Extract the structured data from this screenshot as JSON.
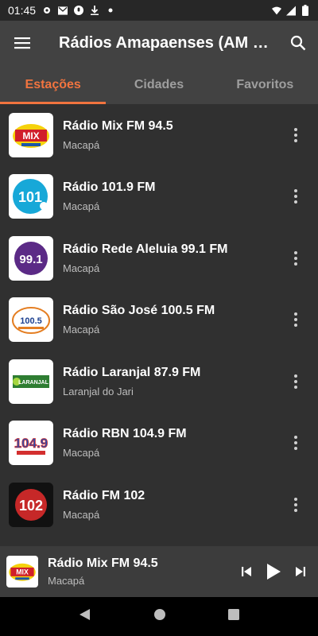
{
  "status_bar": {
    "time": "01:45"
  },
  "app_bar": {
    "title": "Rádios Amapaenses (AM e...",
    "menu_icon": "hamburger-menu-icon",
    "search_icon": "search-icon"
  },
  "tabs": [
    {
      "label": "Estações",
      "active": true
    },
    {
      "label": "Cidades",
      "active": false
    },
    {
      "label": "Favoritos",
      "active": false
    }
  ],
  "stations": [
    {
      "name": "Rádio Mix FM 94.5",
      "city": "Macapá",
      "logo_text": "MIX"
    },
    {
      "name": "Rádio 101.9 FM",
      "city": "Macapá",
      "logo_text": "101"
    },
    {
      "name": "Rádio Rede Aleluia 99.1 FM",
      "city": "Macapá",
      "logo_text": "99.1"
    },
    {
      "name": "Rádio São José 100.5 FM",
      "city": "Macapá",
      "logo_text": "100.5"
    },
    {
      "name": "Rádio Laranjal 87.9 FM",
      "city": "Laranjal do Jari",
      "logo_text": "LARANJAL"
    },
    {
      "name": "Rádio RBN 104.9 FM",
      "city": "Macapá",
      "logo_text": "104.9"
    },
    {
      "name": "Rádio FM 102",
      "city": "Macapá",
      "logo_text": "102"
    }
  ],
  "player": {
    "title": "Rádio Mix FM 94.5",
    "subtitle": "Macapá",
    "logo_text": "MIX"
  },
  "colors": {
    "accent": "#f2743f",
    "app_bar": "#424242",
    "background": "#303030"
  }
}
